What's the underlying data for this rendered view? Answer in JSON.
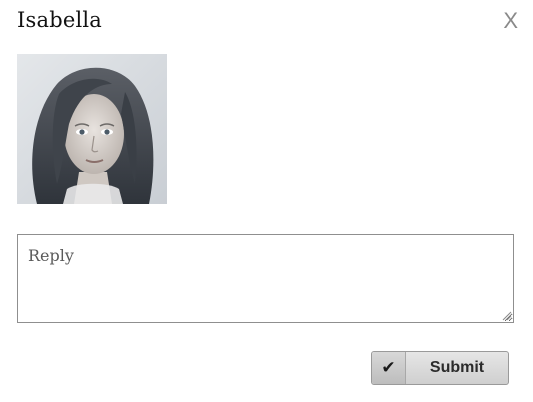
{
  "dialog": {
    "title": "Isabella",
    "close_label": "X"
  },
  "avatar": {
    "icon": "portrait-photo"
  },
  "reply": {
    "placeholder": "Reply",
    "value": ""
  },
  "submit": {
    "icon": "check-icon",
    "check_glyph": "✔",
    "label": "Submit"
  }
}
